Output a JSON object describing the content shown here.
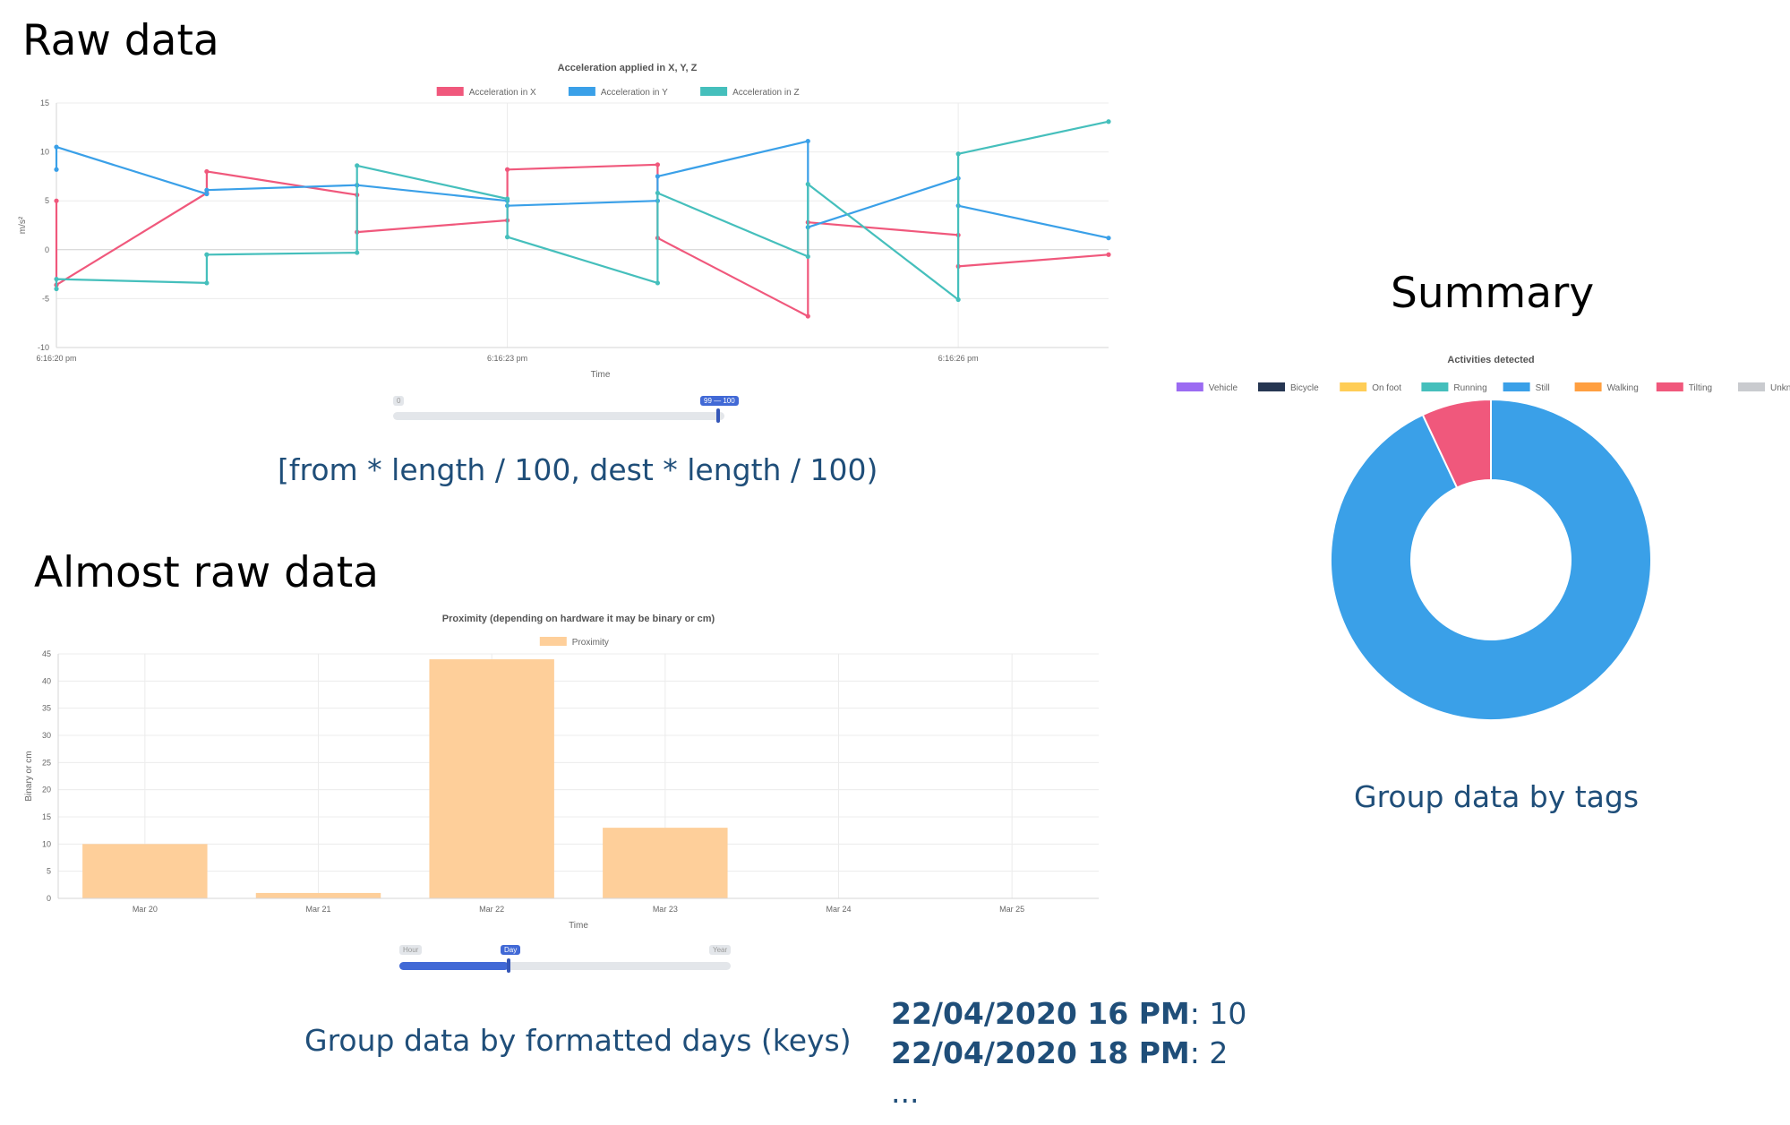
{
  "sections": {
    "raw_heading": "Raw data",
    "raw_caption": "[from * length / 100, dest * length / 100)",
    "almost_heading": "Almost raw data",
    "almost_caption": "Group data by formatted days (keys)",
    "summary_heading": "Summary",
    "summary_caption": "Group data by tags"
  },
  "range_slider": {
    "min_label": "0",
    "value_label": "99 — 100"
  },
  "granularity_slider": {
    "left_label": "Hour",
    "active_label": "Day",
    "right_label": "Year",
    "position": 0.33
  },
  "examples": [
    {
      "key": "22/04/2020 16 PM",
      "sep": ": ",
      "value": "10"
    },
    {
      "key": "22/04/2020 18 PM",
      "sep": ": ",
      "value": "2"
    }
  ],
  "examples_more": "...",
  "colors": {
    "x": "#f0587c",
    "y": "#3aa0e8",
    "z": "#45bfbc",
    "bar": "#fecf9a",
    "heading": "#1f4e79"
  },
  "chart_data": [
    {
      "type": "line",
      "title": "Acceleration applied in X, Y, Z",
      "xlabel": "Time",
      "ylabel": "m/s²",
      "ylim": [
        -10,
        15
      ],
      "yticks": [
        -10,
        -5,
        0,
        5,
        10,
        15
      ],
      "x_ticks": [
        "6:16:20 pm",
        "6:16:23 pm",
        "6:16:26 pm"
      ],
      "x_tick_positions": [
        0,
        3,
        6
      ],
      "xlim": [
        0,
        7
      ],
      "legend_position": "top",
      "series": [
        {
          "name": "Acceleration in X",
          "color": "#f0587c",
          "points": [
            [
              0,
              5
            ],
            [
              0,
              -3.6
            ],
            [
              1,
              5.8
            ],
            [
              1,
              8
            ],
            [
              2,
              5.6
            ],
            [
              2,
              1.8
            ],
            [
              3,
              3
            ],
            [
              3,
              8.2
            ],
            [
              4,
              8.7
            ],
            [
              4,
              1.2
            ],
            [
              5,
              -6.8
            ],
            [
              5,
              2.8
            ],
            [
              6,
              1.5
            ],
            [
              6,
              -1.7
            ],
            [
              7,
              -0.5
            ]
          ]
        },
        {
          "name": "Acceleration in Y",
          "color": "#3aa0e8",
          "points": [
            [
              0,
              8.2
            ],
            [
              0,
              10.5
            ],
            [
              1,
              5.7
            ],
            [
              1,
              6.1
            ],
            [
              2,
              6.6
            ],
            [
              2,
              6.6
            ],
            [
              3,
              5
            ],
            [
              3,
              4.5
            ],
            [
              4,
              5
            ],
            [
              4,
              7.5
            ],
            [
              5,
              11.1
            ],
            [
              5,
              2.3
            ],
            [
              6,
              7.3
            ],
            [
              6,
              4.5
            ],
            [
              7,
              1.2
            ]
          ]
        },
        {
          "name": "Acceleration in Z",
          "color": "#45bfbc",
          "points": [
            [
              0,
              -4
            ],
            [
              0,
              -3
            ],
            [
              1,
              -3.4
            ],
            [
              1,
              -0.5
            ],
            [
              2,
              -0.3
            ],
            [
              2,
              8.6
            ],
            [
              3,
              5.2
            ],
            [
              3,
              1.3
            ],
            [
              4,
              -3.4
            ],
            [
              4,
              5.8
            ],
            [
              5,
              -0.7
            ],
            [
              5,
              6.7
            ],
            [
              6,
              -5.1
            ],
            [
              6,
              9.8
            ],
            [
              7,
              13.1
            ]
          ]
        }
      ]
    },
    {
      "type": "bar",
      "title": "Proximity (depending on hardware it may be binary or cm)",
      "xlabel": "Time",
      "ylabel": "Binary or cm",
      "ylim": [
        0,
        45
      ],
      "yticks": [
        0,
        5,
        10,
        15,
        20,
        25,
        30,
        35,
        40,
        45
      ],
      "categories": [
        "Mar 20",
        "Mar 21",
        "Mar 22",
        "Mar 23",
        "Mar 24",
        "Mar 25"
      ],
      "series": [
        {
          "name": "Proximity",
          "color": "#fecf9a",
          "values": [
            10,
            1,
            44,
            13,
            0,
            0
          ]
        }
      ],
      "legend_position": "top"
    },
    {
      "type": "pie",
      "title": "Activities detected",
      "legend_position": "top",
      "categories": [
        "Vehicle",
        "Bicycle",
        "On foot",
        "Running",
        "Still",
        "Walking",
        "Tilting",
        "Unknown"
      ],
      "colors": [
        "#9b6bf2",
        "#263652",
        "#ffcd56",
        "#45bfbc",
        "#3aa0e8",
        "#ff9f40",
        "#f0587c",
        "#c9cbcf"
      ],
      "values": [
        0,
        0,
        0,
        0,
        93,
        0,
        7,
        0
      ]
    }
  ]
}
